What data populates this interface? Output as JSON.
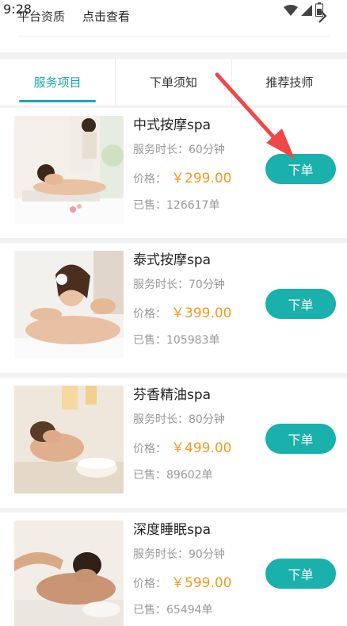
{
  "status_bar": {
    "time": "9:28"
  },
  "header": {
    "qualification_label": "平台资质",
    "view_link": "点击查看"
  },
  "tabs": [
    {
      "label": "服务项目",
      "active": true
    },
    {
      "label": "下单须知",
      "active": false
    },
    {
      "label": "推荐技师",
      "active": false
    }
  ],
  "items": [
    {
      "name": "中式按摩spa",
      "duration": "服务时长：60分钟",
      "price_label": "价格：",
      "price": "￥299.00",
      "sold": "已售：126617单",
      "button": "下单"
    },
    {
      "name": "泰式按摩spa",
      "duration": "服务时长：70分钟",
      "price_label": "价格：",
      "price": "￥399.00",
      "sold": "已售：105983单",
      "button": "下单"
    },
    {
      "name": "芬香精油spa",
      "duration": "服务时长：80分钟",
      "price_label": "价格：",
      "price": "￥499.00",
      "sold": "已售：89602单",
      "button": "下单"
    },
    {
      "name": "深度睡眠spa",
      "duration": "服务时长：90分钟",
      "price_label": "价格：",
      "price": "￥599.00",
      "sold": "已售：65494单",
      "button": "下单"
    }
  ],
  "colors": {
    "accent": "#1aa9a8",
    "price": "#f39a1a",
    "button": "#1ab0ab",
    "annotation_arrow": "#f04848"
  }
}
